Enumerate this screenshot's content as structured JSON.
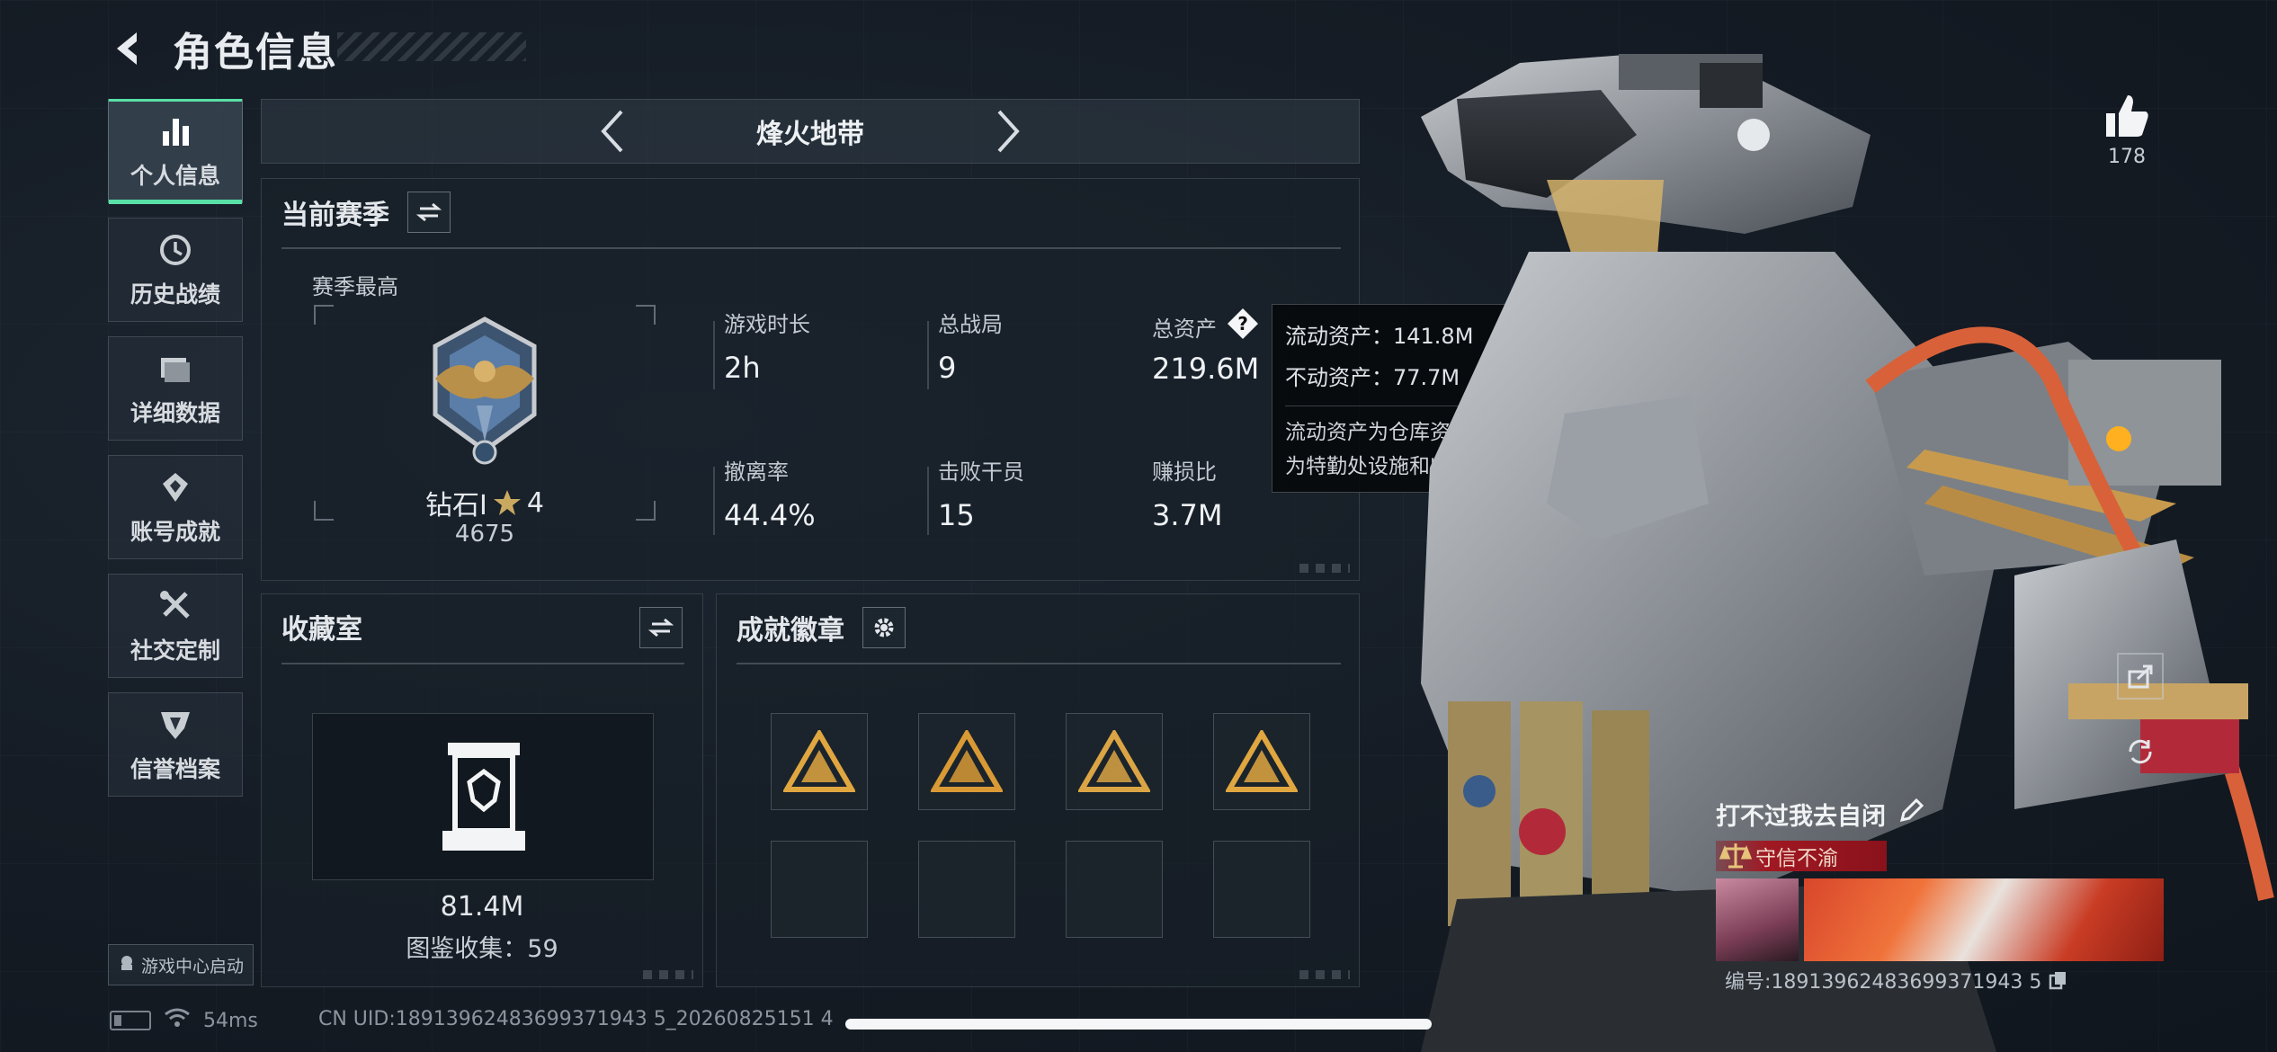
{
  "header": {
    "title": "角色信息"
  },
  "sidebar": {
    "items": [
      {
        "label": "个人信息",
        "icon": "bar-chart-icon",
        "active": true
      },
      {
        "label": "历史战绩",
        "icon": "history-icon",
        "active": false
      },
      {
        "label": "详细数据",
        "icon": "folder-icon",
        "active": false
      },
      {
        "label": "账号成就",
        "icon": "achievement-icon",
        "active": false
      },
      {
        "label": "社交定制",
        "icon": "tools-icon",
        "active": false
      },
      {
        "label": "信誉档案",
        "icon": "credit-icon",
        "active": false
      }
    ],
    "launch_label": "游戏中心启动"
  },
  "status": {
    "ping": "54ms",
    "uid": "CN UID:18913962483699371943 5_20260825151 4"
  },
  "mode": {
    "title": "烽火地带"
  },
  "season": {
    "title": "当前赛季",
    "best_label": "赛季最高",
    "rank_name": "钻石I",
    "rank_stars": "4",
    "rank_score": "4675",
    "stats": [
      {
        "label": "游戏时长",
        "value": "2h"
      },
      {
        "label": "总战局",
        "value": "9"
      },
      {
        "label": "总资产",
        "value": "219.6M"
      },
      {
        "label": "撤离率",
        "value": "44.4%"
      },
      {
        "label": "击败干员",
        "value": "15"
      },
      {
        "label": "赚损比",
        "value": "3.7M"
      }
    ]
  },
  "tooltip": {
    "liquid": "流动资产：141.8M",
    "fixed": "不动资产：77.7M",
    "desc_line1": "流动资产为仓库资产和哈夫币，不动资产",
    "desc_line2": "为特勤处设施和收藏室设施"
  },
  "collection": {
    "title": "收藏室",
    "value": "81.4M",
    "count": "图鉴收集：59"
  },
  "badges": {
    "title": "成就徽章",
    "slots_filled": 4,
    "slots_total": 8,
    "badge_colors": [
      "#e0a640",
      "#d99a35",
      "#dba545",
      "#e0a640"
    ]
  },
  "player": {
    "like_count": "178",
    "name": "打不过我去自闭",
    "honor": "守信不渝",
    "id": "编号:18913962483699371943 5"
  },
  "colors": {
    "accent": "#58e0a6",
    "honor": "#a01822",
    "badge_gold": "#e0a640"
  }
}
